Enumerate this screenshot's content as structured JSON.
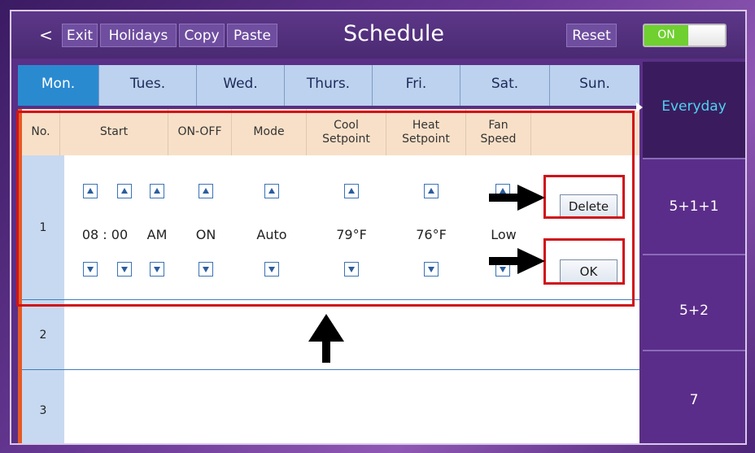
{
  "topbar": {
    "back_glyph": "<",
    "exit_label": "Exit",
    "holidays_label": "Holidays",
    "copy_label": "Copy",
    "paste_label": "Paste",
    "title": "Schedule",
    "reset_label": "Reset",
    "toggle_label": "ON"
  },
  "tabs": [
    {
      "label": "Mon.",
      "active": true
    },
    {
      "label": "Tues."
    },
    {
      "label": "Wed."
    },
    {
      "label": "Thurs."
    },
    {
      "label": "Fri."
    },
    {
      "label": "Sat."
    },
    {
      "label": "Sun."
    }
  ],
  "table": {
    "headers": {
      "no": "No.",
      "start": "Start",
      "onoff": "ON-OFF",
      "mode": "Mode",
      "cool_1": "Cool",
      "cool_2": "Setpoint",
      "heat_1": "Heat",
      "heat_2": "Setpoint",
      "fan_1": "Fan",
      "fan_2": "Speed"
    },
    "row1": {
      "number": "1",
      "time": "08 : 00",
      "ampm": "AM",
      "onoff": "ON",
      "mode": "Auto",
      "cool": "79°F",
      "heat": "76°F",
      "fan": "Low",
      "delete_label": "Delete",
      "ok_label": "OK"
    },
    "row2": {
      "number": "2"
    },
    "row3": {
      "number": "3"
    }
  },
  "side": {
    "items": [
      "Everyday",
      "5+1+1",
      "5+2",
      "7"
    ],
    "selected": "Everyday"
  },
  "colors": {
    "accent_blue": "#2a8ad0",
    "highlight_red": "#d01219",
    "toggle_green": "#6fd02f",
    "sidebar_purple": "#4e2677"
  }
}
